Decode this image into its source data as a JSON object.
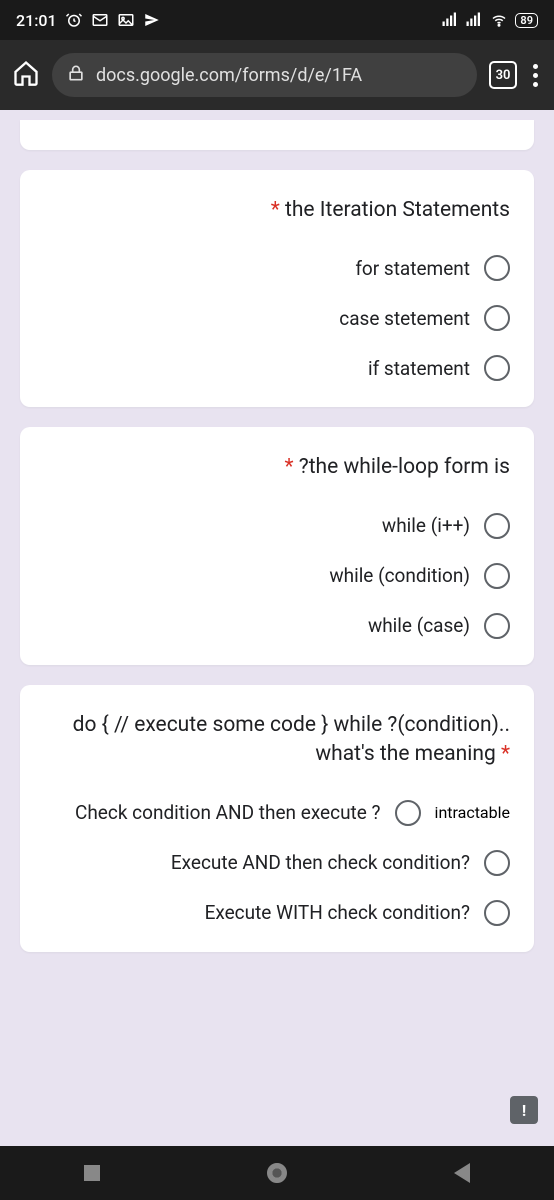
{
  "status": {
    "time": "21:01",
    "battery": "89"
  },
  "browser": {
    "url": "docs.google.com/forms/d/e/1FA",
    "tab_count": "30"
  },
  "questions": [
    {
      "title": "the Iteration Statements",
      "options": [
        "for statement",
        "case stetement",
        "if statement"
      ]
    },
    {
      "title": "?the while-loop form is",
      "options": [
        "while (i++)",
        "while (condition)",
        "while (case)"
      ]
    },
    {
      "title": "do { // execute some code } while ?(condition).. what's the meaning",
      "options": [
        "Check condition AND then execute ?",
        "Execute AND then check condition?",
        "Execute WITH check condition?"
      ]
    }
  ],
  "report_badge": "!"
}
